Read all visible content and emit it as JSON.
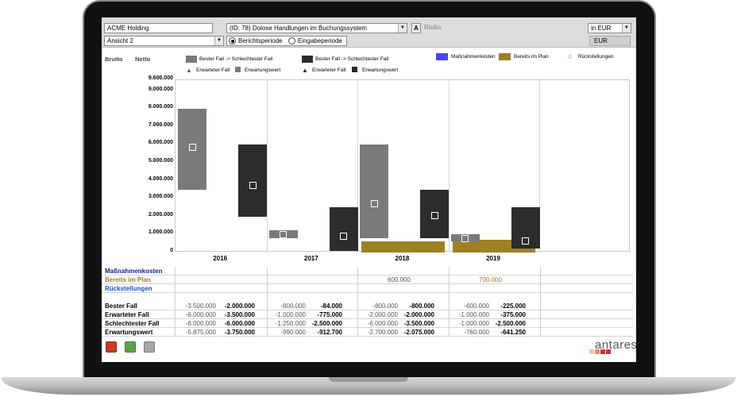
{
  "header": {
    "company": "ACME Holding",
    "risk_select": "(ID: 78) Dolose Handlungen im Buchungssystem",
    "a_button": "A",
    "risiko_label": "Risiko",
    "currency_select": "in EUR",
    "view_select": "Ansicht 2",
    "period_options": [
      "Berichtsperiode",
      "Eingabeperiode"
    ],
    "period_selected": 0,
    "currency_label": "EUR"
  },
  "legend": {
    "brutto": "Brutto",
    "netto": "Netto",
    "brutto_range": "Bester Fall -> Schlechtester Fall",
    "netto_range": "Bester Fall -> Schlechtester Fall",
    "expected": "Erwarteter Fall",
    "expectation_value": "Erwartungswert",
    "measures_cost": "Maßnahmenkosten",
    "in_plan": "Bereits im Plan",
    "provisions": "Rückstellungen",
    "colors": {
      "brutto": "#7a7a7a",
      "netto": "#2c2c2c",
      "measures": "#4444ff",
      "plan": "#9c8125",
      "provisions": "#1a4fb0"
    }
  },
  "chart_data": {
    "type": "bar",
    "categories": [
      "2016",
      "2017",
      "2018",
      "2019"
    ],
    "ylim": [
      0,
      9600000
    ],
    "yticks": [
      "9.600.000",
      "9.000.000",
      "8.000.000",
      "7.000.000",
      "6.000.000",
      "5.000.000",
      "4.000.000",
      "3.000.000",
      "2.000.000",
      "1.000.000",
      "0"
    ],
    "series": [
      {
        "name": "Brutto",
        "best": [
          3500000,
          800000,
          800000,
          600000
        ],
        "worst": [
          8000000,
          1250000,
          6000000,
          1000000
        ],
        "expected": [
          6000000,
          1000000,
          2000000,
          600000
        ],
        "expectation_value": [
          5875000,
          990000,
          2700000,
          760000
        ]
      },
      {
        "name": "Netto",
        "best": [
          2000000,
          84000,
          800000,
          225000
        ],
        "worst": [
          6000000,
          2500000,
          3500000,
          2500000
        ],
        "expected": [
          3500000,
          775000,
          2000000,
          375000
        ],
        "expectation_value": [
          3750000,
          912700,
          2075000,
          641250
        ]
      }
    ],
    "in_plan": [
      0,
      0,
      600000,
      700000
    ]
  },
  "table": {
    "extra_rows": [
      {
        "label": "Maßnahmenkosten",
        "values": [
          "",
          "",
          "",
          ""
        ]
      },
      {
        "label": "Bereits im Plan",
        "values": [
          "",
          "",
          "600.000",
          "700.000"
        ]
      },
      {
        "label": "Rückstellungen",
        "values": [
          "",
          "",
          "",
          ""
        ]
      }
    ],
    "value_rows": [
      {
        "label": "Bester Fall",
        "values": [
          "-3.500.000",
          "-2.000.000",
          "-800.000",
          "-84.000",
          "-800.000",
          "-800.000",
          "-600.000",
          "-225.000"
        ]
      },
      {
        "label": "Erwarteter Fall",
        "values": [
          "-6.000.000",
          "-3.500.000",
          "-1.000.000",
          "-775.000",
          "-2.000.000",
          "-2.000.000",
          "-1.000.000",
          "-375.000"
        ]
      },
      {
        "label": "Schlechtester Fall",
        "values": [
          "-8.000.000",
          "-6.000.000",
          "-1.250.000",
          "-2.500.000",
          "-6.000.000",
          "-3.500.000",
          "-1.000.000",
          "-2.500.000"
        ]
      },
      {
        "label": "Erwartungswert",
        "values": [
          "-5.875.000",
          "-3.750.000",
          "-990.000",
          "-912.700",
          "-2.700.000",
          "-2.075.000",
          "-760.000",
          "-641.250"
        ]
      }
    ]
  },
  "footer": {
    "logo": "antares",
    "icons": [
      "home-icon",
      "back-icon",
      "print-icon"
    ]
  }
}
